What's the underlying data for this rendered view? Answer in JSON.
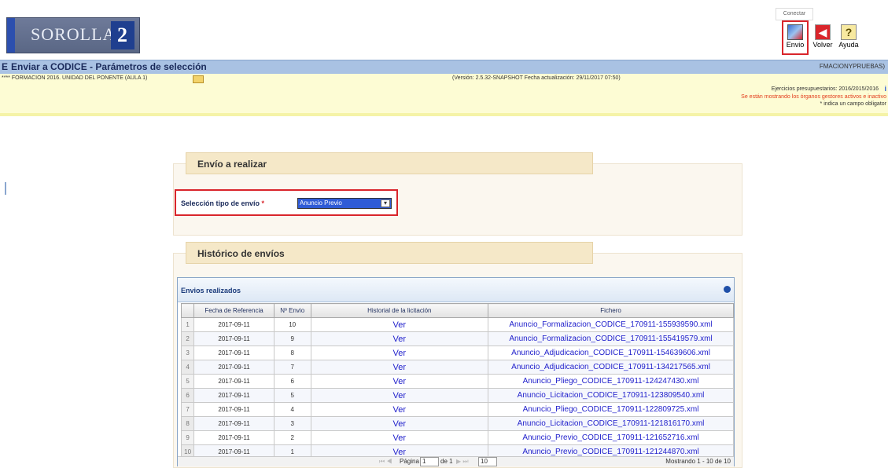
{
  "app": {
    "logo_text": "SOROLLA",
    "logo_suffix": "2"
  },
  "toolbar": {
    "tooltip": "Conectar",
    "items": [
      {
        "label": "Envio",
        "icon": "send-icon"
      },
      {
        "label": "Volver",
        "icon": "back-arrow-icon"
      },
      {
        "label": "Ayuda",
        "icon": "help-icon"
      }
    ]
  },
  "titlebar": {
    "title": "Enviar a CODICE - Parámetros de selección",
    "user": "FMACIONYPRUEBAS)"
  },
  "info": {
    "org": "**** FORMACION 2016. UNIDAD DEL PONENTE (AULA 1)",
    "version": "(Versión: 2.5.32-SNAPSHOT Fecha actualización: 29/11/2017 07:50)",
    "ejercicios": "Ejercicios presupuestarios: 2016/2015/2016",
    "warning": "Se están mostrando los órganos gestores activos e inactivo",
    "required_note": "* indica un campo obligator"
  },
  "envio_section": {
    "title": "Envío a realizar",
    "field_label": "Selección tipo de envío",
    "required_mark": "*",
    "selected_value": "Anuncio Previo"
  },
  "historico_section": {
    "title": "Histórico de envíos"
  },
  "grid": {
    "caption": "Envios realizados",
    "headers": [
      "Fecha de Referencia",
      "Nº Envio",
      "Historial de la licitación",
      "Fichero"
    ],
    "rows": [
      {
        "n": "1",
        "fecha": "2017-09-11",
        "envio": "10",
        "historial": "Ver",
        "fichero": "Anuncio_Formalizacion_CODICE_170911-155939590.xml"
      },
      {
        "n": "2",
        "fecha": "2017-09-11",
        "envio": "9",
        "historial": "Ver",
        "fichero": "Anuncio_Formalizacion_CODICE_170911-155419579.xml"
      },
      {
        "n": "3",
        "fecha": "2017-09-11",
        "envio": "8",
        "historial": "Ver",
        "fichero": "Anuncio_Adjudicacion_CODICE_170911-154639606.xml"
      },
      {
        "n": "4",
        "fecha": "2017-09-11",
        "envio": "7",
        "historial": "Ver",
        "fichero": "Anuncio_Adjudicacion_CODICE_170911-134217565.xml"
      },
      {
        "n": "5",
        "fecha": "2017-09-11",
        "envio": "6",
        "historial": "Ver",
        "fichero": "Anuncio_Pliego_CODICE_170911-124247430.xml"
      },
      {
        "n": "6",
        "fecha": "2017-09-11",
        "envio": "5",
        "historial": "Ver",
        "fichero": "Anuncio_Licitacion_CODICE_170911-123809540.xml"
      },
      {
        "n": "7",
        "fecha": "2017-09-11",
        "envio": "4",
        "historial": "Ver",
        "fichero": "Anuncio_Pliego_CODICE_170911-122809725.xml"
      },
      {
        "n": "8",
        "fecha": "2017-09-11",
        "envio": "3",
        "historial": "Ver",
        "fichero": "Anuncio_Licitacion_CODICE_170911-121816170.xml"
      },
      {
        "n": "9",
        "fecha": "2017-09-11",
        "envio": "2",
        "historial": "Ver",
        "fichero": "Anuncio_Previo_CODICE_170911-121652716.xml"
      },
      {
        "n": "10",
        "fecha": "2017-09-11",
        "envio": "1",
        "historial": "Ver",
        "fichero": "Anuncio_Previo_CODICE_170911-121244870.xml"
      }
    ],
    "pager": {
      "page_label": "Página",
      "page": "1",
      "of_label": "de 1",
      "page_size": "10",
      "summary": "Mostrando 1 - 10 de 10"
    }
  },
  "colors": {
    "titlebar": "#a9c2e3",
    "info_bg": "#fdfcd4",
    "highlight": "#d9252b",
    "section_header": "#f5e8c8",
    "link": "#2222cc"
  }
}
